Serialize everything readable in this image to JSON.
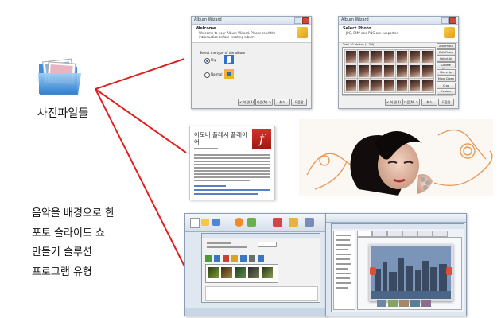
{
  "folder": {
    "label": "사진파일들"
  },
  "description": {
    "lines": [
      "음악을 배경으로 한",
      "포토 슬라이드 쇼",
      "만들기 솔루션",
      "프로그램 유형"
    ]
  },
  "wizard1": {
    "title": "Album Wizard",
    "header": "Welcome",
    "subtitle": "Welcome to your Album Wizard. Please read the introduction before creating album.",
    "prompt": "Select the type of the album",
    "option1": "Flip",
    "option2": "Normal",
    "buttons": [
      "< 이전(B)",
      "다음(N) >",
      "취소",
      "도움말"
    ]
  },
  "wizard2": {
    "title": "Album Wizard",
    "header": "Select Photo",
    "subtitle": "JPG, BMP and PNG are supported",
    "total": "Total 30 photos (1.3M)",
    "side_buttons": [
      "Add Photo",
      "Edit Photo",
      "Select All",
      "Delete Photo",
      "Move Up",
      "Move Down",
      "Crop",
      "Explore"
    ],
    "buttons": [
      "< 이전(B)",
      "다음(N) >",
      "취소",
      "도움말"
    ]
  },
  "flash": {
    "title": "어도비 플래시 플레이어",
    "logo_letter": "f"
  },
  "colors": {
    "connector": "#e02020",
    "accent": "#d6312b"
  }
}
